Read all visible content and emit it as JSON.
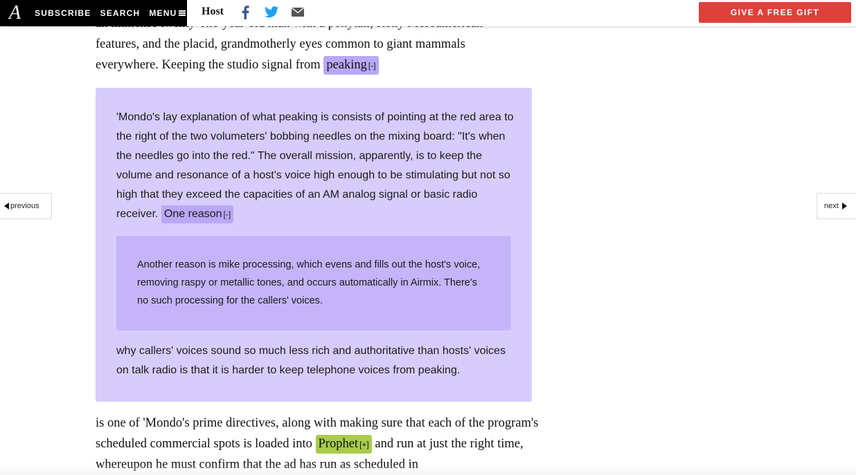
{
  "topbar": {
    "logo": "A",
    "nav": {
      "subscribe": "SUBSCRIBE",
      "search": "SEARCH",
      "menu": "MENU"
    },
    "title": "Host",
    "gift_button": "GIVE A FREE GIFT",
    "icons": [
      "facebook-icon",
      "twitter-icon",
      "email-icon"
    ],
    "colors": {
      "facebook": "#3b5998",
      "twitter": "#1da1f2",
      "email": "#555555",
      "gift": "#e0403a"
    }
  },
  "article": {
    "para_top": {
      "line0": "an immense twenty-one-year-old man with a ponytail, stony Mesoamerican",
      "line1": "features, and the placid, grandmotherly eyes common to giant mammals",
      "line2_text": "everywhere. Keeping the studio signal from ",
      "toggle_label": "peaking",
      "toggle_sign": "[-]"
    },
    "note1": {
      "text_a": "'Mondo's lay explanation of what peaking is consists of pointing at the red area to the right of the two volumeters' bobbing needles on the mixing board: \"It's when the needles go into the red.\" The overall mission, apparently, is to keep the volume and resonance of a host's voice high enough to be stimulating but not so high that they exceed the capacities of an AM analog signal or basic radio receiver. ",
      "toggle_label": "One reason",
      "toggle_sign": "[-]",
      "text_b": "why callers' voices sound so much less rich and authoritative than hosts' voices on talk radio is that it is harder to keep telephone voices from peaking."
    },
    "note2": {
      "text": "Another reason is mike processing, which evens and fills out the host's voice, removing raspy or metallic tones, and occurs automatically in Airmix. There's no such processing for the callers' voices."
    },
    "para_bottom": {
      "text_a": "is one of 'Mondo's prime directives, along with making sure that each of the program's scheduled commercial spots is loaded into ",
      "toggle_label": "Prophet",
      "toggle_sign": "[+]",
      "text_b": " and run at just the right time, whereupon he must confirm that the ad has run as scheduled in"
    },
    "colors": {
      "note1_bg": "#d7cdfc",
      "note2_bg": "#c6b4fb",
      "toggle_purple": "#b9a8f7",
      "toggle_green": "#a8cc4b"
    }
  },
  "side_nav": {
    "previous": "previous",
    "next": "next"
  }
}
